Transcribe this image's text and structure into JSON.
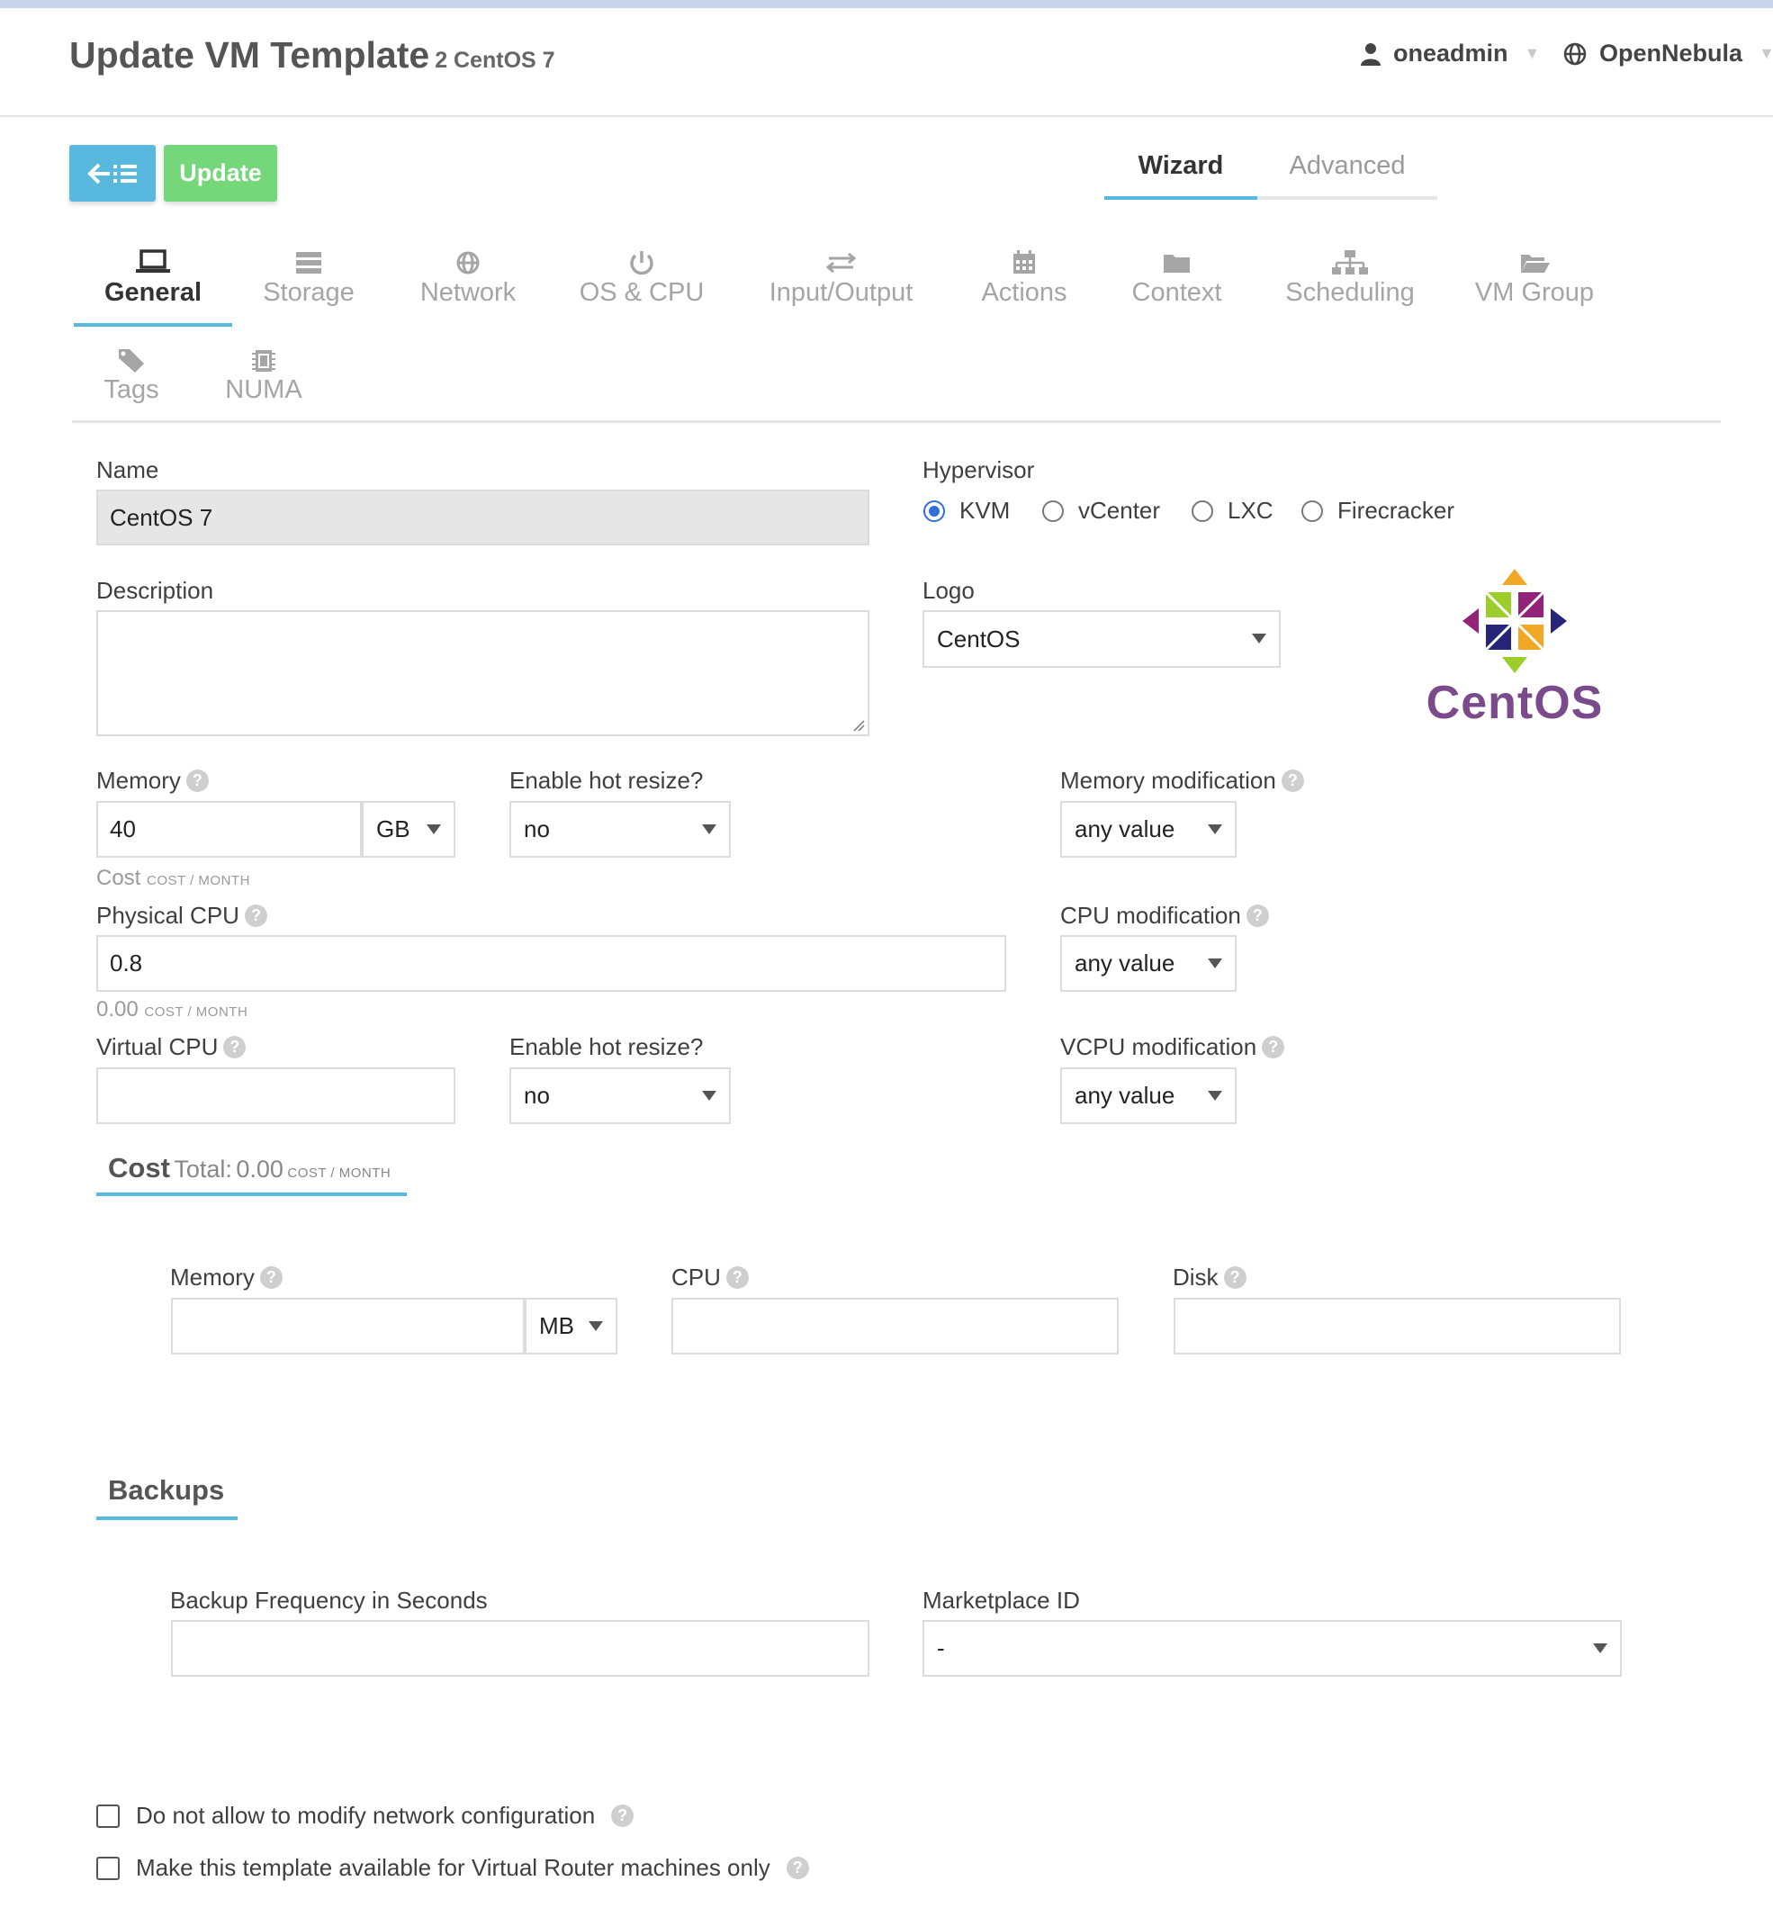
{
  "header": {
    "title": "Update VM Template",
    "subtitle": "2 CentOS 7",
    "user": "oneadmin",
    "zone": "OpenNebula"
  },
  "toolbar": {
    "update_label": "Update"
  },
  "mode_tabs": {
    "wizard": "Wizard",
    "advanced": "Advanced"
  },
  "tabs": {
    "general": "General",
    "storage": "Storage",
    "network": "Network",
    "os_cpu": "OS & CPU",
    "input_output": "Input/Output",
    "actions": "Actions",
    "context": "Context",
    "scheduling": "Scheduling",
    "vm_group": "VM Group",
    "tags": "Tags",
    "numa": "NUMA"
  },
  "general": {
    "name_label": "Name",
    "name_value": "CentOS 7",
    "description_label": "Description",
    "description_value": "",
    "hypervisor_label": "Hypervisor",
    "hypervisors": [
      "KVM",
      "vCenter",
      "LXC",
      "Firecracker"
    ],
    "hypervisor_selected": "KVM",
    "logo_label": "Logo",
    "logo_value": "CentOS",
    "logo_text": "CentOS",
    "memory_label": "Memory",
    "memory_value": "40",
    "memory_unit": "GB",
    "memory_hot_label": "Enable hot resize?",
    "memory_hot_value": "no",
    "memory_mod_label": "Memory modification",
    "memory_mod_value": "any value",
    "memory_cost_label": "Cost",
    "cost_unit": "COST / MONTH",
    "pcpu_label": "Physical CPU",
    "pcpu_value": "0.8",
    "pcpu_cost_value": "0.00",
    "cpu_mod_label": "CPU modification",
    "cpu_mod_value": "any value",
    "vcpu_label": "Virtual CPU",
    "vcpu_value": "",
    "vcpu_hot_label": "Enable hot resize?",
    "vcpu_hot_value": "no",
    "vcpu_mod_label": "VCPU modification",
    "vcpu_mod_value": "any value"
  },
  "cost": {
    "title": "Cost",
    "total_label": "Total:",
    "total_value": "0.00",
    "memory_label": "Memory",
    "memory_value": "",
    "memory_unit": "MB",
    "cpu_label": "CPU",
    "cpu_value": "",
    "disk_label": "Disk",
    "disk_value": ""
  },
  "backups": {
    "title": "Backups",
    "frequency_label": "Backup Frequency in Seconds",
    "frequency_value": "",
    "marketplace_label": "Marketplace ID",
    "marketplace_value": "-"
  },
  "options": {
    "no_network_mod": "Do not allow to modify network configuration",
    "vrouter_only": "Make this template available for Virtual Router machines only"
  },
  "colors": {
    "accent": "#59b8de",
    "update_green": "#74d779",
    "radio_blue": "#2f6fd6"
  }
}
